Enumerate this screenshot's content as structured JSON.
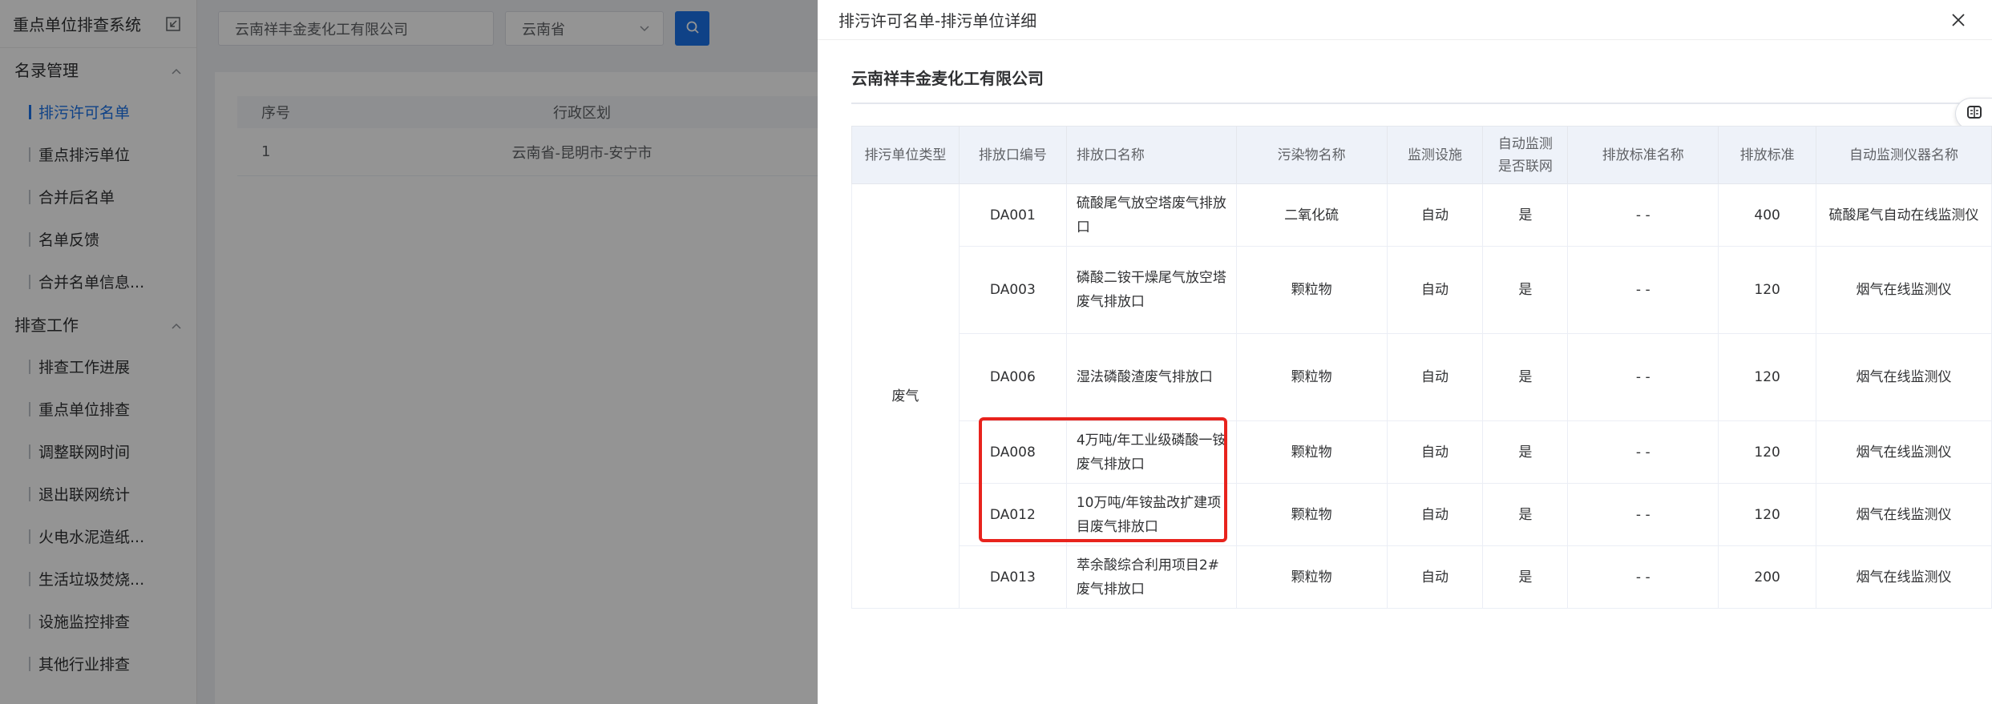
{
  "sidebar": {
    "title": "重点单位排查系统",
    "groups": [
      {
        "label": "名录管理",
        "items": [
          "排污许可名单",
          "重点排污单位",
          "合并后名单",
          "名单反馈",
          "合并名单信息..."
        ]
      },
      {
        "label": "排查工作",
        "items": [
          "排查工作进展",
          "重点单位排查",
          "调整联网时间",
          "退出联网统计",
          "火电水泥造纸...",
          "生活垃圾焚烧...",
          "设施监控排查",
          "其他行业排查"
        ]
      }
    ],
    "active_item": "排污许可名单"
  },
  "toolbar": {
    "company_value": "云南祥丰金麦化工有限公司",
    "province_value": "云南省"
  },
  "background_table": {
    "headers": [
      "序号",
      "行政区划"
    ],
    "rows": [
      [
        "1",
        "云南省-昆明市-安宁市"
      ]
    ]
  },
  "drawer": {
    "title": "排污许可名单-排污单位详细",
    "company": "云南祥丰金麦化工有限公司",
    "headers": [
      "排污单位类型",
      "排放口编号",
      "排放口名称",
      "污染物名称",
      "监测设施",
      "自动监测\n是否联网",
      "排放标准名称",
      "排放标准",
      "自动监测仪器名称"
    ],
    "unit_type": "废气",
    "rows": [
      [
        "DA001",
        "硫酸尾气放空塔废气排放口",
        "二氧化硫",
        "自动",
        "是",
        "- -",
        "400",
        "硫酸尾气自动在线监测仪"
      ],
      [
        "DA003",
        "磷酸二铵干燥尾气放空塔废气排放口",
        "颗粒物",
        "自动",
        "是",
        "- -",
        "120",
        "烟气在线监测仪"
      ],
      [
        "DA006",
        "湿法磷酸渣废气排放口",
        "颗粒物",
        "自动",
        "是",
        "- -",
        "120",
        "烟气在线监测仪"
      ],
      [
        "DA008",
        "4万吨/年工业级磷酸一铵废气排放口",
        "颗粒物",
        "自动",
        "是",
        "- -",
        "120",
        "烟气在线监测仪"
      ],
      [
        "DA012",
        "10万吨/年铵盐改扩建项目废气排放口",
        "颗粒物",
        "自动",
        "是",
        "- -",
        "120",
        "烟气在线监测仪"
      ],
      [
        "DA013",
        "萃余酸综合利用项目2#废气排放口",
        "颗粒物",
        "自动",
        "是",
        "- -",
        "200",
        "烟气在线监测仪"
      ]
    ]
  },
  "colors": {
    "accent": "#1a73e8",
    "highlight": "#e8231d"
  }
}
